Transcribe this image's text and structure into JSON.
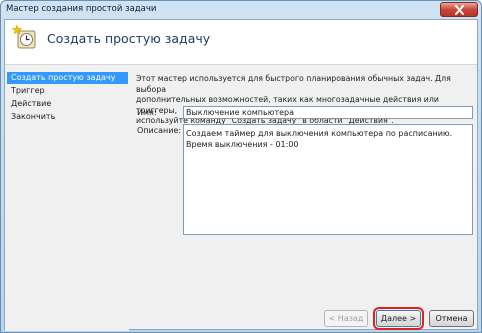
{
  "window": {
    "title": "Мастер создания простой задачи"
  },
  "header": {
    "title": "Создать простую задачу",
    "icon": "task-scheduler-icon"
  },
  "nav": {
    "items": [
      {
        "label": "Создать простую задачу",
        "active": true
      },
      {
        "label": "Триггер",
        "active": false
      },
      {
        "label": "Действие",
        "active": false
      },
      {
        "label": "Закончить",
        "active": false
      }
    ]
  },
  "main": {
    "description_lines": [
      "Этот мастер используется для быстрого планирования обычных задач.  Для выбора",
      "дополнительных возможностей, таких как многозадачные действия или триггеры,",
      "используйте команду \"Создать задачу\" в области \"Действия\"."
    ],
    "name_label": "Имя:",
    "name_value": "Выключение компьютера",
    "description_label": "Описание:",
    "description_value": "Создаем таймер для выключения компьютера по расписанию. Время выключения - 01:00"
  },
  "footer": {
    "back_label": "< Назад",
    "next_label": "Далее >",
    "cancel_label": "Отмена"
  },
  "colors": {
    "accent": "#3399ff",
    "highlight": "#e0221b",
    "close": "#c8463a"
  }
}
